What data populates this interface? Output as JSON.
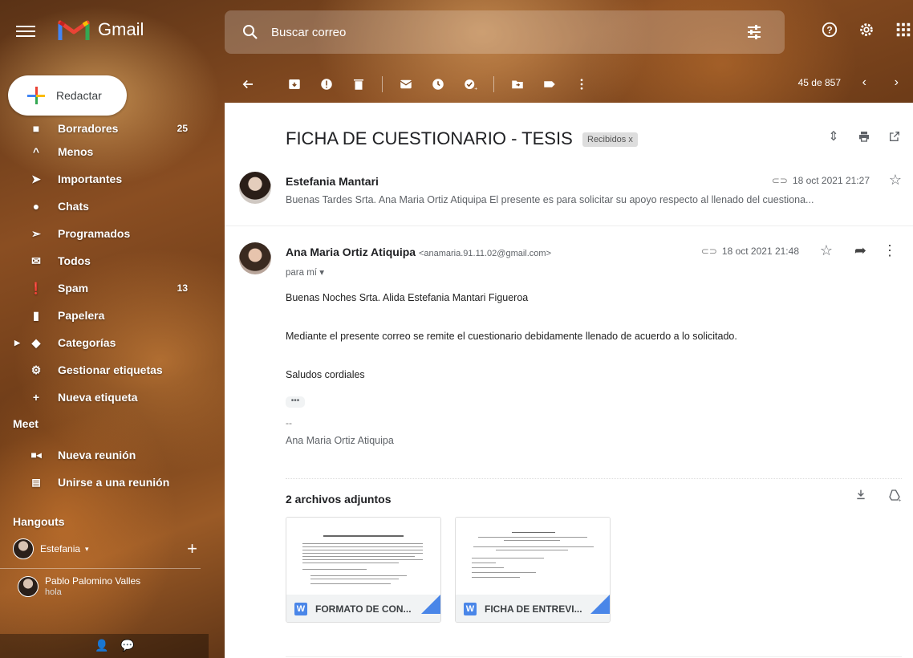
{
  "app": {
    "name": "Gmail"
  },
  "search": {
    "placeholder": "Buscar correo"
  },
  "compose": {
    "label": "Redactar"
  },
  "sidebar": {
    "items": [
      {
        "label": "Borradores",
        "count": "25",
        "icon": "draft-icon"
      },
      {
        "label": "Menos",
        "icon": "chevron-up-icon"
      },
      {
        "label": "Importantes",
        "icon": "label-important-icon"
      },
      {
        "label": "Chats",
        "icon": "chat-icon"
      },
      {
        "label": "Programados",
        "icon": "scheduled-send-icon"
      },
      {
        "label": "Todos",
        "icon": "all-mail-icon"
      },
      {
        "label": "Spam",
        "count": "13",
        "icon": "spam-icon"
      },
      {
        "label": "Papelera",
        "icon": "trash-icon"
      },
      {
        "label": "Categorías",
        "icon": "label-icon"
      },
      {
        "label": "Gestionar etiquetas",
        "icon": "gear-icon"
      },
      {
        "label": "Nueva etiqueta",
        "icon": "plus-icon"
      }
    ],
    "meet": {
      "title": "Meet",
      "items": [
        {
          "label": "Nueva reunión",
          "icon": "video-icon"
        },
        {
          "label": "Unirse a una reunión",
          "icon": "keyboard-icon"
        }
      ]
    },
    "hangouts": {
      "title": "Hangouts",
      "users": [
        {
          "name": "Estefania"
        },
        {
          "name": "Pablo Palomino Valles",
          "status": "hola"
        }
      ]
    }
  },
  "toolbar": {
    "counter": "45 de 857"
  },
  "thread": {
    "subject": "FICHA DE CUESTIONARIO - TESIS",
    "label": "Recibidos x",
    "messages": [
      {
        "sender": "Estefania Mantari",
        "date": "18 oct 2021 21:27",
        "snippet": "Buenas Tardes Srta. Ana Maria Ortiz Atiquipa El presente es para solicitar su apoyo respecto al llenado del cuestiona..."
      },
      {
        "sender": "Ana Maria Ortiz Atiquipa",
        "email": "<anamaria.91.11.02@gmail.com>",
        "to": "para mí",
        "date": "18 oct 2021 21:48",
        "body": [
          "Buenas Noches Srta. Alida Estefania Mantari Figueroa",
          "Mediante el presente correo se remite el cuestionario debidamente llenado de acuerdo a lo solicitado.",
          "Saludos cordiales"
        ],
        "ellipsis": "•••",
        "sig_dash": "--",
        "signature": "Ana Maria Ortiz Atiquipa"
      }
    ],
    "attachments": {
      "title": "2 archivos adjuntos",
      "files": [
        {
          "name": "FORMATO DE CON...",
          "type": "W"
        },
        {
          "name": "FICHA DE ENTREVI...",
          "type": "W"
        }
      ]
    }
  }
}
